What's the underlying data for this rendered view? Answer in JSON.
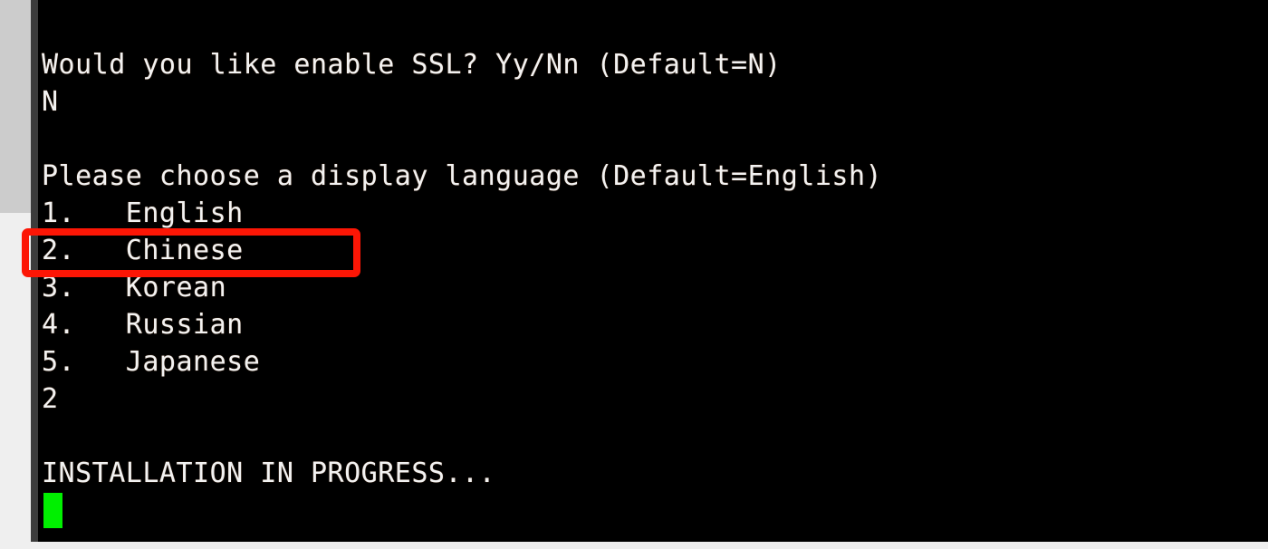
{
  "window": {
    "kind": "terminal-console",
    "background_color": "#000000",
    "text_color": "#f2f2f2",
    "gutter_color": "#cccccc",
    "page_color": "#efefef",
    "divider_color": "#3c3c3c"
  },
  "terminal": {
    "lines": [
      "Would you like enable SSL? Yy/Nn (Default=N)",
      "N",
      "",
      "Please choose a display language (Default=English)",
      "1.   English",
      "2.   Chinese",
      "3.   Korean",
      "4.   Russian",
      "5.   Japanese",
      "2",
      "",
      "INSTALLATION IN PROGRESS..."
    ],
    "prompts": {
      "ssl_question": "Would you like enable SSL? Yy/Nn (Default=N)",
      "ssl_answer": "N",
      "language_question": "Please choose a display language (Default=English)",
      "language_answer": "2",
      "status": "INSTALLATION IN PROGRESS..."
    },
    "language_menu": [
      {
        "number": "1.",
        "label": "English"
      },
      {
        "number": "2.",
        "label": "Chinese"
      },
      {
        "number": "3.",
        "label": "Korean"
      },
      {
        "number": "4.",
        "label": "Russian"
      },
      {
        "number": "5.",
        "label": "Japanese"
      }
    ],
    "cursor": {
      "color": "#00f000",
      "shape": "block"
    }
  },
  "annotation": {
    "target_label": "2.   Chinese",
    "color": "#fc1605",
    "stroke_width": "8"
  }
}
